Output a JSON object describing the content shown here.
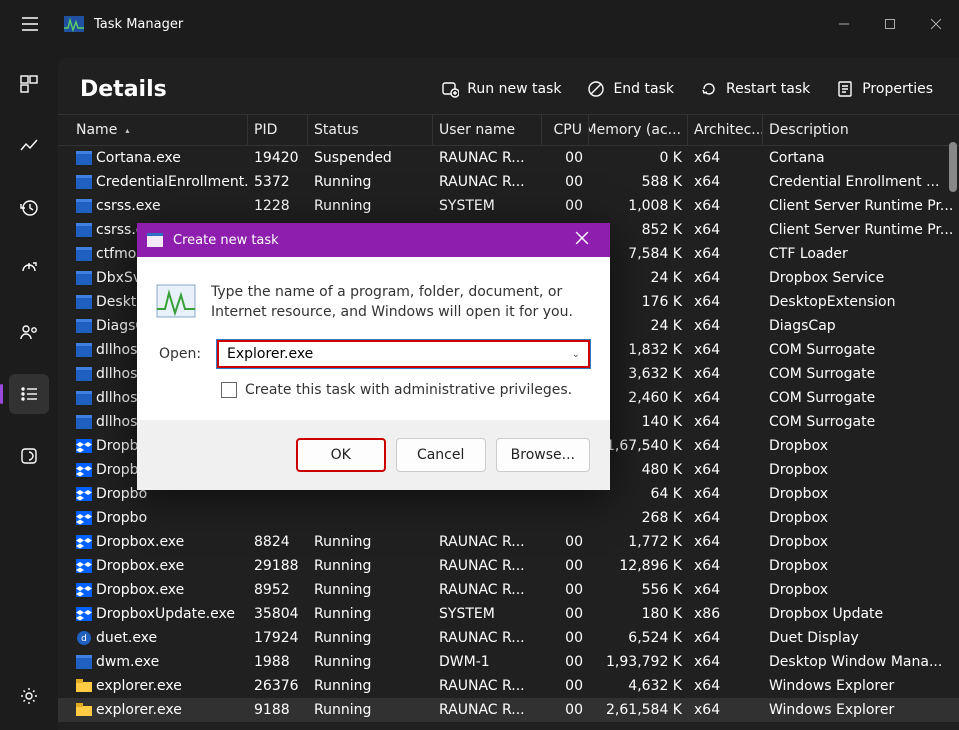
{
  "app": {
    "title": "Task Manager"
  },
  "header": {
    "title": "Details"
  },
  "toolbar": {
    "run_new_task": "Run new task",
    "end_task": "End task",
    "restart_task": "Restart task",
    "properties": "Properties"
  },
  "columns": {
    "name": "Name",
    "pid": "PID",
    "status": "Status",
    "user": "User name",
    "cpu": "CPU",
    "mem": "Memory (ac...",
    "arch": "Architec...",
    "desc": "Description"
  },
  "processes": [
    {
      "icon": "app",
      "name": "Cortana.exe",
      "pid": "19420",
      "status": "Suspended",
      "user": "RAUNAC R...",
      "cpu": "00",
      "mem": "0 K",
      "arch": "x64",
      "desc": "Cortana"
    },
    {
      "icon": "app",
      "name": "CredentialEnrollment...",
      "pid": "5372",
      "status": "Running",
      "user": "RAUNAC R...",
      "cpu": "00",
      "mem": "588 K",
      "arch": "x64",
      "desc": "Credential Enrollment ..."
    },
    {
      "icon": "app",
      "name": "csrss.exe",
      "pid": "1228",
      "status": "Running",
      "user": "SYSTEM",
      "cpu": "00",
      "mem": "1,008 K",
      "arch": "x64",
      "desc": "Client Server Runtime Pr..."
    },
    {
      "icon": "app",
      "name": "csrss.exe",
      "pid": "",
      "status": "",
      "user": "",
      "cpu": "",
      "mem": "852 K",
      "arch": "x64",
      "desc": "Client Server Runtime Pr..."
    },
    {
      "icon": "app",
      "name": "ctfmon",
      "pid": "",
      "status": "",
      "user": "",
      "cpu": "",
      "mem": "7,584 K",
      "arch": "x64",
      "desc": "CTF Loader"
    },
    {
      "icon": "app",
      "name": "DbxSvc",
      "pid": "",
      "status": "",
      "user": "",
      "cpu": "",
      "mem": "24 K",
      "arch": "x64",
      "desc": "Dropbox Service"
    },
    {
      "icon": "app",
      "name": "Desktop",
      "pid": "",
      "status": "",
      "user": "",
      "cpu": "",
      "mem": "176 K",
      "arch": "x64",
      "desc": "DesktopExtension"
    },
    {
      "icon": "app",
      "name": "DiagsC",
      "pid": "",
      "status": "",
      "user": "",
      "cpu": "",
      "mem": "24 K",
      "arch": "x64",
      "desc": "DiagsCap"
    },
    {
      "icon": "app",
      "name": "dllhost.",
      "pid": "",
      "status": "",
      "user": "",
      "cpu": "",
      "mem": "1,832 K",
      "arch": "x64",
      "desc": "COM Surrogate"
    },
    {
      "icon": "app",
      "name": "dllhost.",
      "pid": "",
      "status": "",
      "user": "",
      "cpu": "",
      "mem": "3,632 K",
      "arch": "x64",
      "desc": "COM Surrogate"
    },
    {
      "icon": "app",
      "name": "dllhost.",
      "pid": "",
      "status": "",
      "user": "",
      "cpu": "",
      "mem": "2,460 K",
      "arch": "x64",
      "desc": "COM Surrogate"
    },
    {
      "icon": "app",
      "name": "dllhost.",
      "pid": "",
      "status": "",
      "user": "",
      "cpu": "",
      "mem": "140 K",
      "arch": "x64",
      "desc": "COM Surrogate"
    },
    {
      "icon": "dropbox",
      "name": "Dropbo",
      "pid": "",
      "status": "",
      "user": "",
      "cpu": "",
      "mem": "1,67,540 K",
      "arch": "x64",
      "desc": "Dropbox"
    },
    {
      "icon": "dropbox",
      "name": "Dropbo",
      "pid": "",
      "status": "",
      "user": "",
      "cpu": "",
      "mem": "480 K",
      "arch": "x64",
      "desc": "Dropbox"
    },
    {
      "icon": "dropbox",
      "name": "Dropbo",
      "pid": "",
      "status": "",
      "user": "",
      "cpu": "",
      "mem": "64 K",
      "arch": "x64",
      "desc": "Dropbox"
    },
    {
      "icon": "dropbox",
      "name": "Dropbo",
      "pid": "",
      "status": "",
      "user": "",
      "cpu": "",
      "mem": "268 K",
      "arch": "x64",
      "desc": "Dropbox"
    },
    {
      "icon": "dropbox",
      "name": "Dropbox.exe",
      "pid": "8824",
      "status": "Running",
      "user": "RAUNAC R...",
      "cpu": "00",
      "mem": "1,772 K",
      "arch": "x64",
      "desc": "Dropbox"
    },
    {
      "icon": "dropbox",
      "name": "Dropbox.exe",
      "pid": "29188",
      "status": "Running",
      "user": "RAUNAC R...",
      "cpu": "00",
      "mem": "12,896 K",
      "arch": "x64",
      "desc": "Dropbox"
    },
    {
      "icon": "dropbox",
      "name": "Dropbox.exe",
      "pid": "8952",
      "status": "Running",
      "user": "RAUNAC R...",
      "cpu": "00",
      "mem": "556 K",
      "arch": "x64",
      "desc": "Dropbox"
    },
    {
      "icon": "dropbox",
      "name": "DropboxUpdate.exe",
      "pid": "35804",
      "status": "Running",
      "user": "SYSTEM",
      "cpu": "00",
      "mem": "180 K",
      "arch": "x86",
      "desc": "Dropbox Update"
    },
    {
      "icon": "duet",
      "name": "duet.exe",
      "pid": "17924",
      "status": "Running",
      "user": "RAUNAC R...",
      "cpu": "00",
      "mem": "6,524 K",
      "arch": "x64",
      "desc": "Duet Display"
    },
    {
      "icon": "app",
      "name": "dwm.exe",
      "pid": "1988",
      "status": "Running",
      "user": "DWM-1",
      "cpu": "00",
      "mem": "1,93,792 K",
      "arch": "x64",
      "desc": "Desktop Window Mana..."
    },
    {
      "icon": "folder",
      "name": "explorer.exe",
      "pid": "26376",
      "status": "Running",
      "user": "RAUNAC R...",
      "cpu": "00",
      "mem": "4,632 K",
      "arch": "x64",
      "desc": "Windows Explorer"
    },
    {
      "icon": "folder",
      "name": "explorer.exe",
      "pid": "9188",
      "status": "Running",
      "user": "RAUNAC R...",
      "cpu": "00",
      "mem": "2,61,584 K",
      "arch": "x64",
      "desc": "Windows Explorer",
      "selected": true
    }
  ],
  "dialog": {
    "title": "Create new task",
    "description": "Type the name of a program, folder, document, or Internet resource, and Windows will open it for you.",
    "open_label": "Open:",
    "input_value": "Explorer.exe",
    "admin_checkbox_label": "Create this task with administrative privileges.",
    "ok": "OK",
    "cancel": "Cancel",
    "browse": "Browse..."
  }
}
